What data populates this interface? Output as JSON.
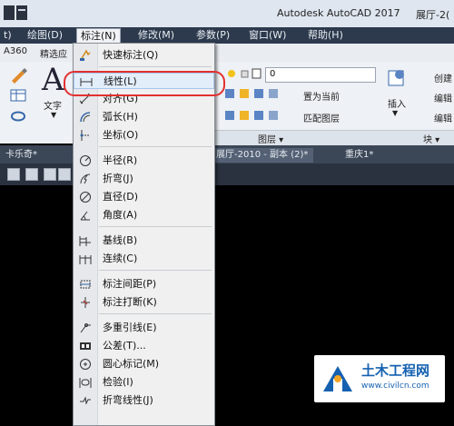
{
  "title_bar": {
    "app_title": "Autodesk AutoCAD 2017",
    "doc_title": "展厅-2("
  },
  "menubar": {
    "items": [
      "t)",
      "绘图(D)",
      "标注(N)",
      "修改(M)",
      "参数(P)",
      "窗口(W)",
      "帮助(H)"
    ],
    "active_index": 2
  },
  "ribbon": {
    "tabs": [
      "A360",
      "精选应"
    ],
    "left_labels": {
      "text": "文字"
    },
    "layer_combo_value": "0",
    "layer_buttons": [
      "置为当前",
      "匹配图层"
    ],
    "layer_panel_title": "图层 ▾",
    "insert_label": "插入",
    "block_labels": [
      "创建",
      "编辑",
      "编辑"
    ],
    "block_panel_title": "块 ▾"
  },
  "document_tabs": [
    "卡乐奇*",
    "展厅-2010 - 副本 (2)*",
    "重庆1*"
  ],
  "dropdown": {
    "items": [
      {
        "label": "快速标注(Q)",
        "icon": "quick-dimension-icon"
      },
      {
        "label": "线性(L)",
        "icon": "linear-dimension-icon",
        "highlighted": true
      },
      {
        "label": "对齐(G)",
        "icon": "aligned-dimension-icon"
      },
      {
        "label": "弧长(H)",
        "icon": "arc-length-icon"
      },
      {
        "label": "坐标(O)",
        "icon": "ordinate-icon"
      },
      {
        "label": "半径(R)",
        "icon": "radius-icon"
      },
      {
        "label": "折弯(J)",
        "icon": "jogged-icon"
      },
      {
        "label": "直径(D)",
        "icon": "diameter-icon"
      },
      {
        "label": "角度(A)",
        "icon": "angular-icon"
      },
      {
        "label": "基线(B)",
        "icon": "baseline-icon"
      },
      {
        "label": "连续(C)",
        "icon": "continue-icon"
      },
      {
        "label": "标注间距(P)",
        "icon": "dimension-space-icon"
      },
      {
        "label": "标注打断(K)",
        "icon": "dimension-break-icon"
      },
      {
        "label": "多重引线(E)",
        "icon": "multileader-icon"
      },
      {
        "label": "公差(T)...",
        "icon": "tolerance-icon"
      },
      {
        "label": "圆心标记(M)",
        "icon": "center-mark-icon"
      },
      {
        "label": "检验(I)",
        "icon": "inspection-icon"
      },
      {
        "label": "折弯线性(J)",
        "icon": "jogged-linear-icon"
      }
    ]
  },
  "watermark": {
    "main": "土木工程网",
    "sub": "www.civilcn.com"
  },
  "colors": {
    "menubar": "#2d3a4d",
    "highlight_ring": "#e23030",
    "watermark_blue": "#1561b0"
  }
}
